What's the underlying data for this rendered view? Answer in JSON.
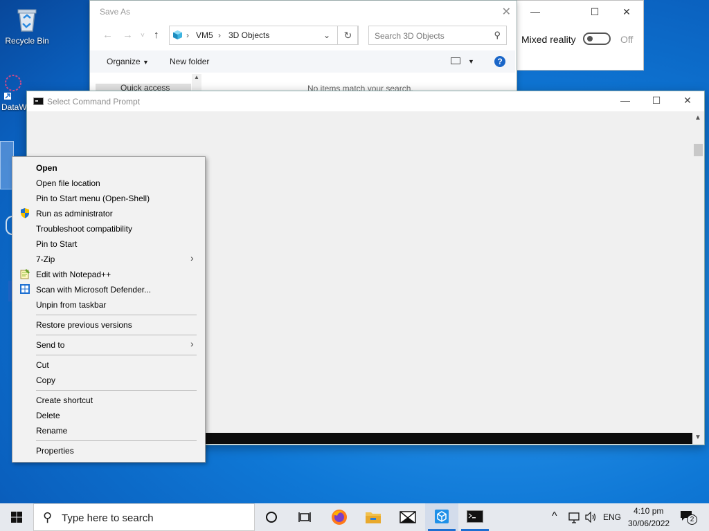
{
  "desktop": {
    "icons": [
      {
        "label": "Recycle Bin",
        "icon": "recycle-bin-icon"
      },
      {
        "label": "DataW",
        "icon": "datawrapper-shortcut-icon"
      }
    ]
  },
  "mixed_reality_window": {
    "label": "Mixed reality",
    "toggle_state": "Off",
    "controls": {
      "minimize": "—",
      "maximize": "☐",
      "close": "✕"
    }
  },
  "save_as": {
    "title": "Save As",
    "breadcrumb": [
      "VM5",
      "3D Objects"
    ],
    "search_placeholder": "Search 3D Objects",
    "toolbar": {
      "organize": "Organize",
      "new_folder": "New folder"
    },
    "nav_pane_item": "Quick access",
    "empty_message": "No items match your search."
  },
  "cmd": {
    "title": "Select Command Prompt",
    "controls": {
      "minimize": "—",
      "maximize": "☐",
      "close": "✕"
    }
  },
  "context_menu": {
    "items": [
      {
        "label": "Open",
        "bold": true
      },
      {
        "label": "Open file location"
      },
      {
        "label": "Pin to Start menu (Open-Shell)"
      },
      {
        "label": "Run as administrator",
        "icon": "uac-shield-icon"
      },
      {
        "label": "Troubleshoot compatibility"
      },
      {
        "label": "Pin to Start"
      },
      {
        "label": "7-Zip",
        "submenu": true
      },
      {
        "label": "Edit with Notepad++",
        "icon": "notepad-plus-plus-icon"
      },
      {
        "label": "Scan with Microsoft Defender...",
        "icon": "defender-icon"
      },
      {
        "label": "Unpin from taskbar"
      },
      {
        "label": "Restore previous versions"
      },
      {
        "label": "Send to",
        "submenu": true
      },
      {
        "label": "Cut"
      },
      {
        "label": "Copy"
      },
      {
        "label": "Create shortcut"
      },
      {
        "label": "Delete"
      },
      {
        "label": "Rename"
      },
      {
        "label": "Properties"
      }
    ]
  },
  "taskbar": {
    "search_placeholder": "Type here to search",
    "apps": [
      "cortana-icon",
      "task-view-icon",
      "firefox-icon",
      "file-explorer-icon",
      "mail-icon",
      "3d-viewer-icon",
      "command-prompt-icon"
    ],
    "tray": {
      "language": "ENG",
      "time": "4:10 pm",
      "date": "30/06/2022",
      "notifications": "2"
    }
  },
  "colors": {
    "accent": "#1d6fd1",
    "desktop": "#0f78d6",
    "menu_bg": "#f2f2f2"
  }
}
